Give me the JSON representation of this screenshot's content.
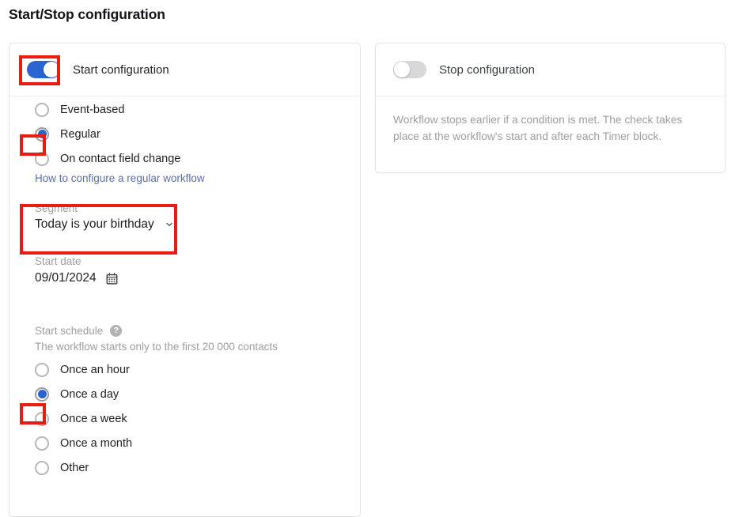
{
  "page": {
    "title": "Start/Stop configuration"
  },
  "start_card": {
    "toggle": {
      "name": "start-configuration-toggle",
      "state": "on"
    },
    "header_title": "Start configuration",
    "trigger_options": [
      {
        "label": "Event-based",
        "checked": false
      },
      {
        "label": "Regular",
        "checked": true
      },
      {
        "label": "On contact field change",
        "checked": false
      }
    ],
    "help_link": "How to configure a regular workflow",
    "segment": {
      "label": "Segment",
      "value": "Today is your birthday",
      "icon": "chevron-down-icon"
    },
    "start_date": {
      "label": "Start date",
      "value": "09/01/2024",
      "icon": "calendar-icon"
    },
    "start_schedule": {
      "label": "Start schedule",
      "help_icon": "help-circle-icon",
      "note": "The workflow starts only to the first 20 000 contacts",
      "options": [
        {
          "label": "Once an hour",
          "checked": false
        },
        {
          "label": "Once a day",
          "checked": true
        },
        {
          "label": "Once a week",
          "checked": false
        },
        {
          "label": "Once a month",
          "checked": false
        },
        {
          "label": "Other",
          "checked": false
        }
      ]
    }
  },
  "stop_card": {
    "toggle": {
      "name": "stop-configuration-toggle",
      "state": "off"
    },
    "header_title": "Stop configuration",
    "description": "Workflow stops earlier if a condition is met. The check takes place at the workflow's start and after each Timer block."
  },
  "colors": {
    "accent_blue": "#2a64d0",
    "annotation_red": "#e81c12",
    "link_blue": "#5b6ea8",
    "muted_gray": "#9e9e9e",
    "toggle_off": "#d7d8da"
  }
}
